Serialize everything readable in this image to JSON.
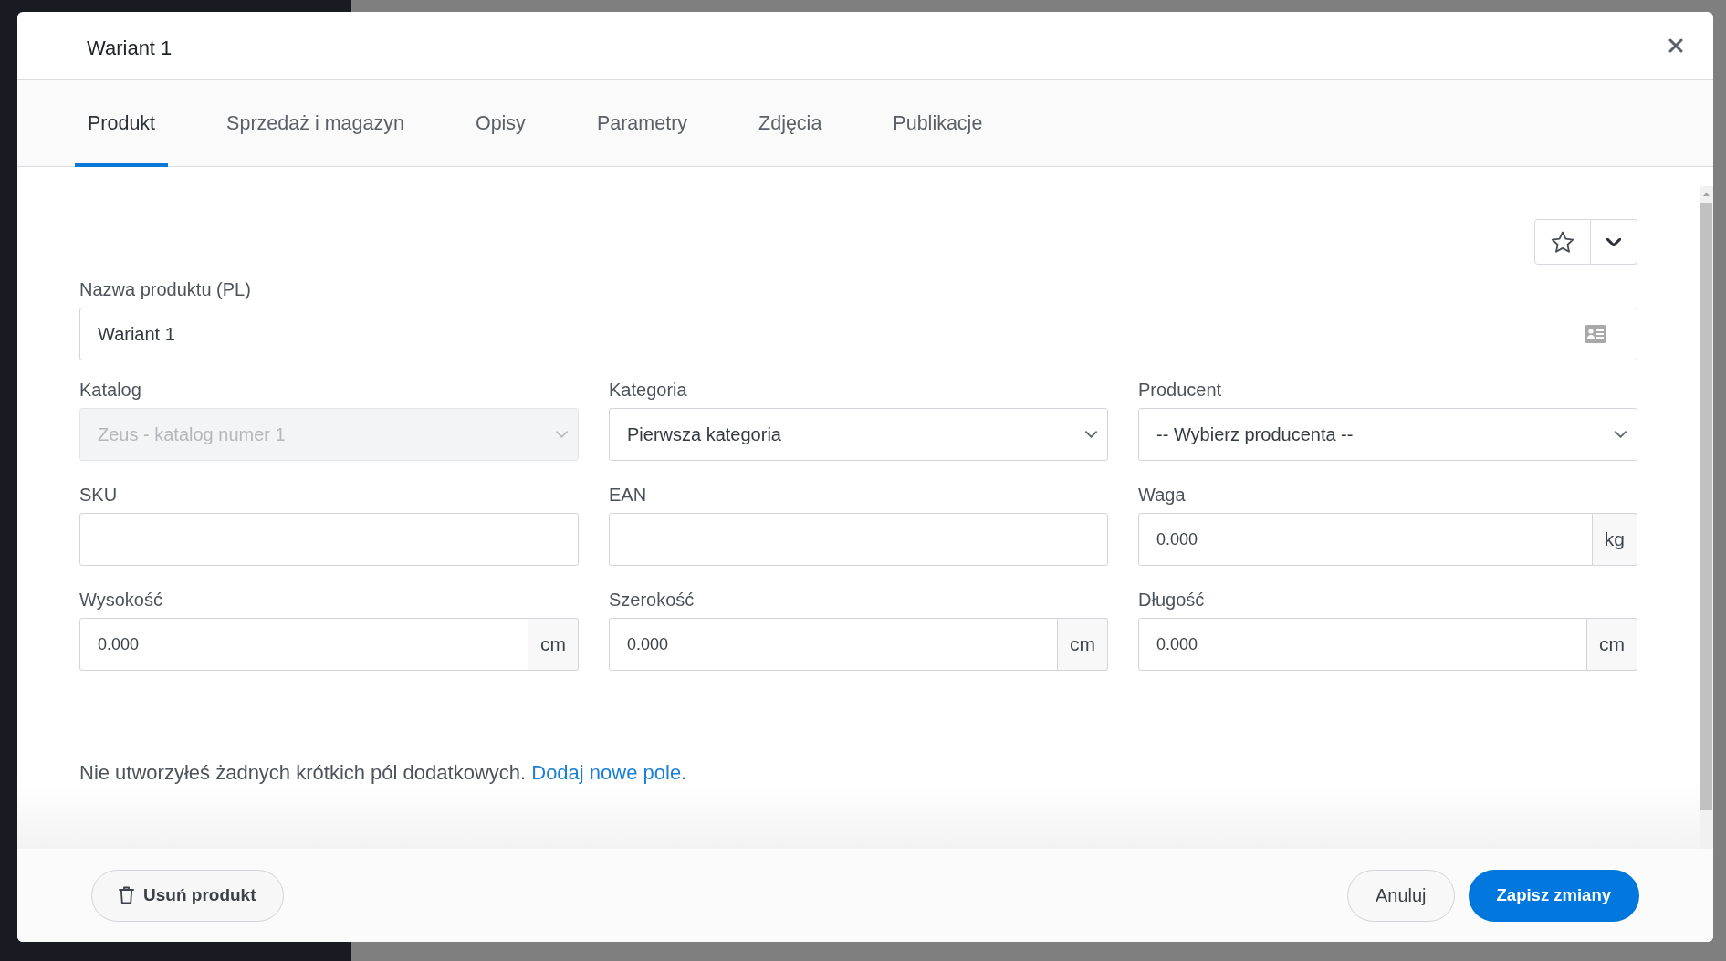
{
  "window": {
    "title": "Wariant 1"
  },
  "tabs": [
    {
      "label": "Produkt",
      "selected": true
    },
    {
      "label": "Sprzedaż i magazyn",
      "selected": false
    },
    {
      "label": "Opisy",
      "selected": false
    },
    {
      "label": "Parametry",
      "selected": false
    },
    {
      "label": "Zdjęcia",
      "selected": false
    },
    {
      "label": "Publikacje",
      "selected": false
    }
  ],
  "product_name": {
    "label": "Nazwa produktu (PL)",
    "value": "Wariant 1"
  },
  "fields": [
    {
      "kind": "select",
      "label": "Katalog",
      "value": "Zeus - katalog numer 1",
      "disabled": true
    },
    {
      "kind": "select",
      "label": "Kategoria",
      "value": "Pierwsza kategoria",
      "disabled": false
    },
    {
      "kind": "select",
      "label": "Producent",
      "value": "-- Wybierz producenta --",
      "disabled": false
    },
    {
      "kind": "text",
      "label": "SKU",
      "disabled": false
    },
    {
      "kind": "text",
      "label": "EAN",
      "disabled": false
    },
    {
      "kind": "unit",
      "label": "Waga",
      "value": "0.000",
      "unit": "kg",
      "disabled": false
    },
    {
      "kind": "unit",
      "label": "Wysokość",
      "value": "0.000",
      "unit": "cm",
      "disabled": false
    },
    {
      "kind": "unit",
      "label": "Szerokość",
      "value": "0.000",
      "unit": "cm",
      "disabled": false
    },
    {
      "kind": "unit",
      "label": "Długość",
      "value": "0.000",
      "unit": "cm",
      "disabled": false
    }
  ],
  "notice": {
    "text": "Nie utworzyłeś żadnych krótkich pól dodatkowych.",
    "link": "Dodaj nowe pole",
    "suffix": "."
  },
  "footer": {
    "delete_button": "Usuń produkt",
    "cancel_button": "Anuluj",
    "save_button": "Zapisz zmiany"
  }
}
